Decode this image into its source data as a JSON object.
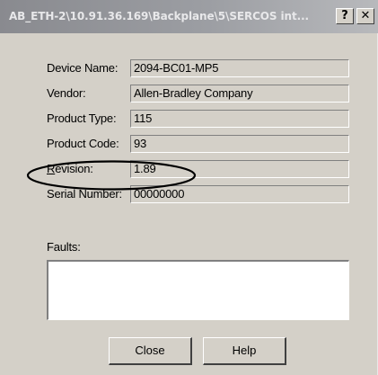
{
  "window": {
    "title": "AB_ETH-2\\10.91.36.169\\Backplane\\5\\SERCOS int...",
    "help_glyph": "?",
    "close_glyph": "✕"
  },
  "properties": [
    {
      "label": "Device Name:",
      "value": "2094-BC01-MP5"
    },
    {
      "label": "Vendor:",
      "value": "Allen-Bradley Company"
    },
    {
      "label": "Product Type:",
      "value": "115"
    },
    {
      "label": "Product Code:",
      "value": "93"
    },
    {
      "label": "Revision:",
      "value": "1.89"
    },
    {
      "label": "Serial Number:",
      "value": "00000000"
    }
  ],
  "faults": {
    "label": "Faults:",
    "value": ""
  },
  "buttons": {
    "close": "Close",
    "help": "Help"
  },
  "colors": {
    "dialog_bg": "#d4d0c8",
    "annotation": "#000000"
  }
}
